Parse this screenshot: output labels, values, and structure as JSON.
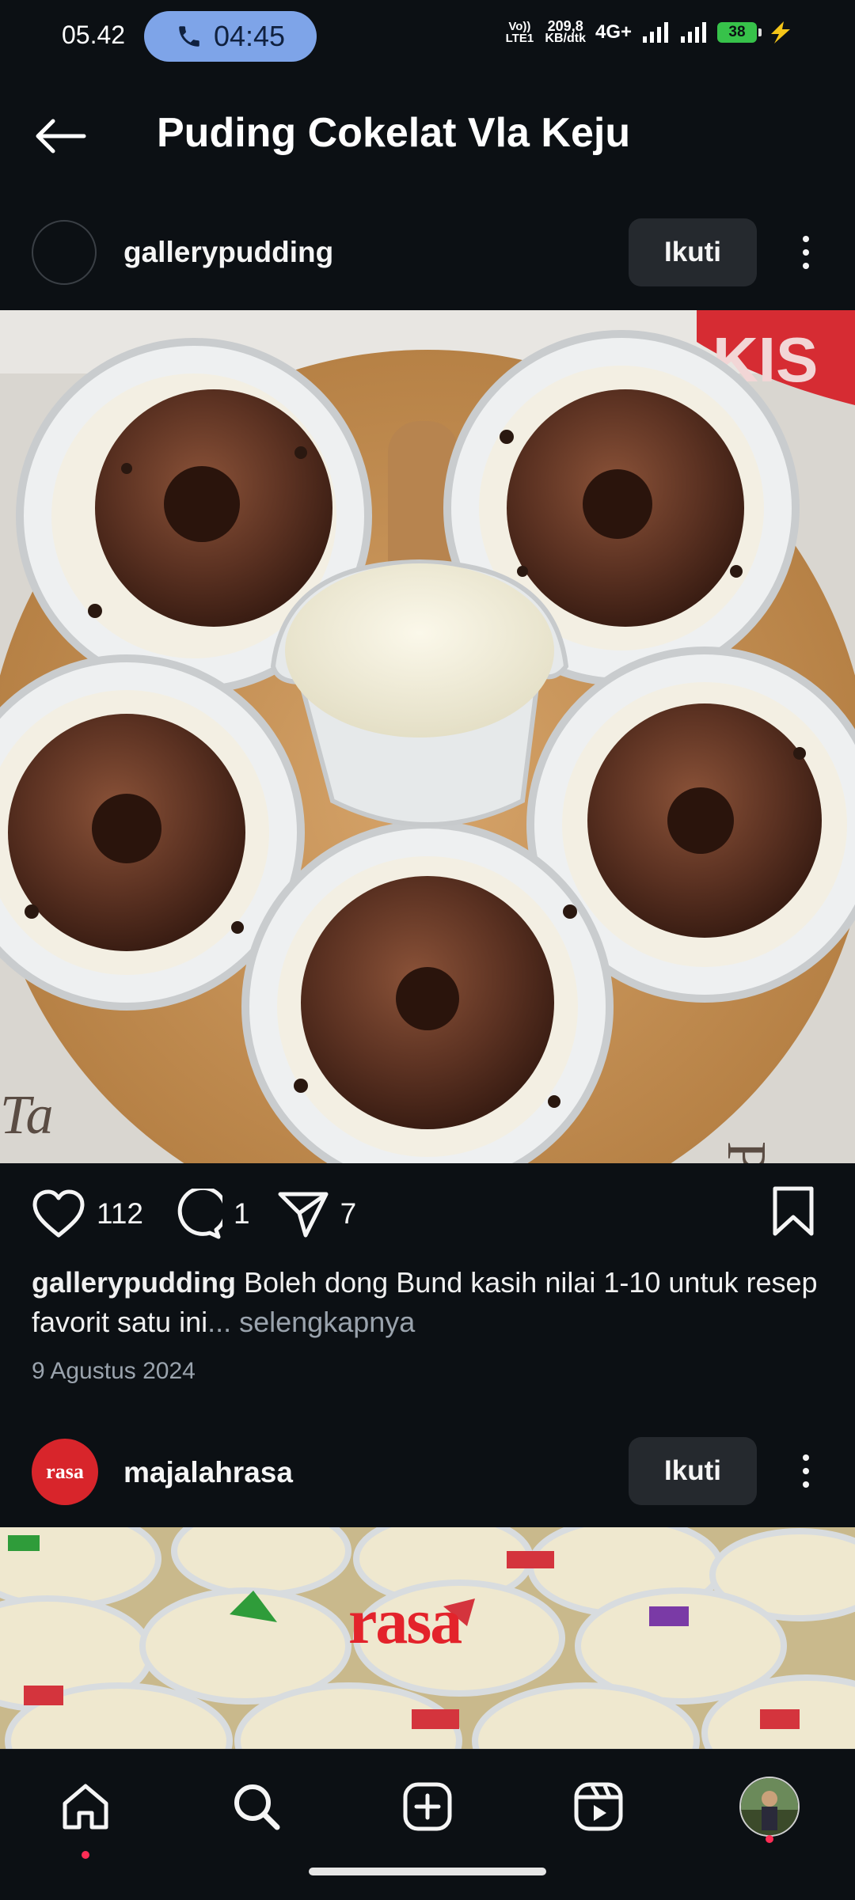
{
  "status_bar": {
    "time": "05.42",
    "call_timer": "04:45",
    "volte": "Vo)) LTE1",
    "speed_value": "209,8",
    "speed_unit": "KB/dtk",
    "network": "4G+",
    "battery": "38"
  },
  "header": {
    "title": "Puding Cokelat Vla Keju"
  },
  "post": {
    "username": "gallerypudding",
    "follow_label": "Ikuti",
    "likes": "112",
    "comments": "1",
    "shares": "7",
    "caption_user": "gallerypudding",
    "caption_text": "Boleh dong Bund kasih nilai 1-10 untuk resep favorit satu ini",
    "caption_more": "... selengkapnya",
    "date": "9 Agustus 2024"
  },
  "post2": {
    "username": "majalahrasa",
    "follow_label": "Ikuti",
    "logo_text": "rasa"
  },
  "nav": {
    "items": [
      "home-icon",
      "search-icon",
      "create-icon",
      "reels-icon",
      "profile-avatar"
    ],
    "accent": "#ff2d55"
  }
}
